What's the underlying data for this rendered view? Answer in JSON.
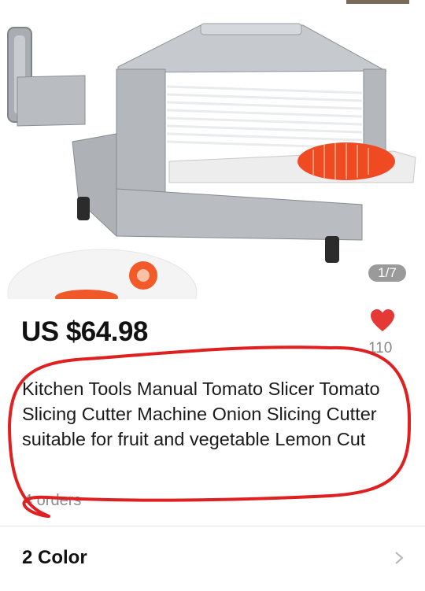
{
  "gallery": {
    "current": 1,
    "total": 7,
    "indicator": "1/7"
  },
  "product": {
    "price": "US $64.98",
    "wishlist_count": "110",
    "title": "Kitchen Tools Manual Tomato Slicer Tomato Slicing Cutter Machine Onion Slicing Cutter suitable for fruit and vegetable Lemon Cut",
    "orders": "4 orders"
  },
  "variants": {
    "label": "2 Color"
  },
  "icons": {
    "wishlist": "heart-icon",
    "variants": "chevron-right-icon"
  },
  "colors": {
    "heart": "#e53935",
    "annotation": "#e02020",
    "indicator_bg": "#9a9a9a"
  }
}
